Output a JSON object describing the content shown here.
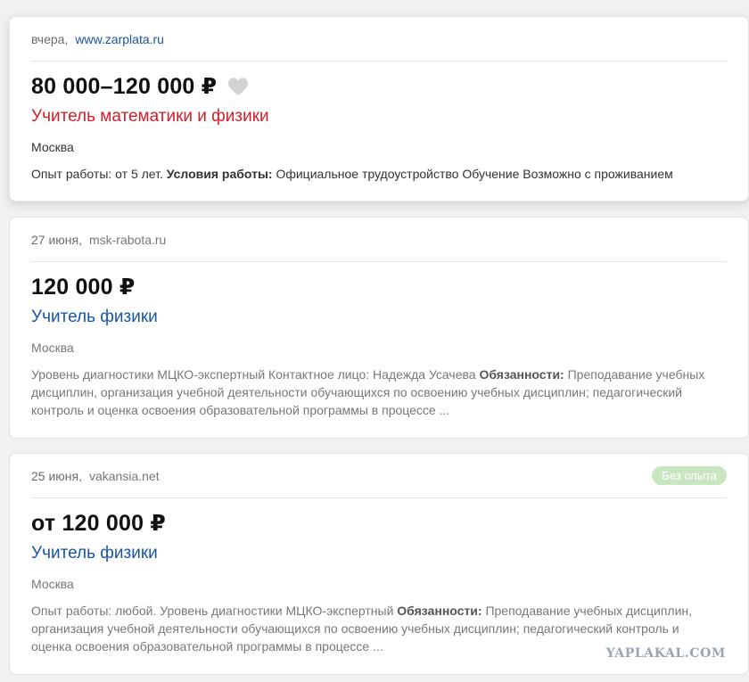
{
  "vacancies": [
    {
      "date": "вчера,",
      "source": "www.zarplata.ru",
      "salary": "80 000–120 000 ₽",
      "title": "Учитель математики и физики",
      "city": "Москва",
      "desc_1": "Опыт работы: от 5 лет. ",
      "bold_1": "Условия работы:",
      "desc_2": " Официальное трудоустройство Обучение Возможно с проживанием"
    },
    {
      "date": "27 июня,",
      "source": "msk-rabota.ru",
      "salary": "120 000 ₽",
      "title": "Учитель физики",
      "city": "Москва",
      "desc_1": "Уровень диагностики МЦКО-экспертный Контактное лицо: Надежда Усачева ",
      "bold_1": "Обязанности:",
      "desc_2": " Преподавание учебных дисциплин, организация учебной деятельности обучающихся по освоению учебных дисциплин; педагогический контроль и оценка освоения образовательной программы в процессе ..."
    },
    {
      "date": "25 июня,",
      "source": "vakansia.net",
      "badge": "Без опыта",
      "salary": "от 120 000 ₽",
      "title": "Учитель физики",
      "city": "Москва",
      "desc_1": "Опыт работы: любой. Уровень диагностики МЦКО-экспертный ",
      "bold_1": "Обязанности:",
      "desc_2": " Преподавание учебных дисциплин, организация учебной деятельности обучающихся по освоению учебных дисциплин; педагогический контроль и оценка освоения образовательной программы в процессе ..."
    }
  ],
  "icons": {
    "favorite": "heart-icon"
  },
  "colors": {
    "link_blue": "#1a55a3",
    "title_red": "#d1202a",
    "badge_green": "#c8e6c0"
  },
  "watermark": "YAPLAKAL.COM"
}
